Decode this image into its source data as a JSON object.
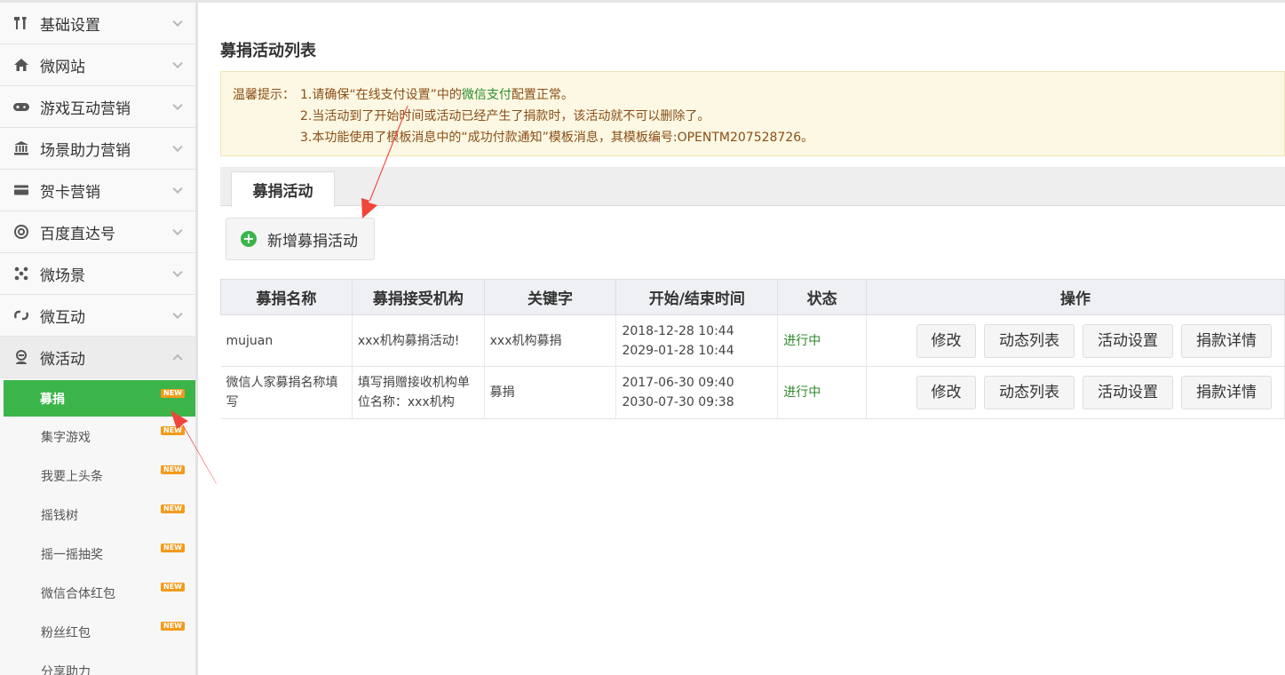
{
  "sidebar": {
    "menu": [
      {
        "label": "基础设置",
        "icon": "tools-icon"
      },
      {
        "label": "微网站",
        "icon": "home-icon"
      },
      {
        "label": "游戏互动营销",
        "icon": "gamepad-icon"
      },
      {
        "label": "场景助力营销",
        "icon": "bank-icon"
      },
      {
        "label": "贺卡营销",
        "icon": "card-icon"
      },
      {
        "label": "百度直达号",
        "icon": "at-icon"
      },
      {
        "label": "微场景",
        "icon": "molecule-icon"
      },
      {
        "label": "微互动",
        "icon": "link-icon"
      },
      {
        "label": "微活动",
        "icon": "user-icon"
      }
    ],
    "submenu": [
      {
        "label": "募捐",
        "badge": "NEW"
      },
      {
        "label": "集字游戏",
        "badge": "NEW"
      },
      {
        "label": "我要上头条",
        "badge": "NEW"
      },
      {
        "label": "摇钱树",
        "badge": "NEW"
      },
      {
        "label": "摇一摇抽奖",
        "badge": "NEW"
      },
      {
        "label": "微信合体红包",
        "badge": "NEW"
      },
      {
        "label": "粉丝红包",
        "badge": "NEW"
      },
      {
        "label": "分享助力",
        "badge": ""
      }
    ]
  },
  "page": {
    "title": "募捐活动列表"
  },
  "notice": {
    "lead": "温馨提示：",
    "line1_pre": "1.请确保“在线支付设置”中的",
    "line1_link": "微信支付",
    "line1_post": "配置正常。",
    "line2": "2.当活动到了开始时间或活动已经产生了捐款时，该活动就不可以删除了。",
    "line3": "3.本功能使用了模板消息中的“成功付款通知”模板消息，其模板编号:OPENTM207528726。"
  },
  "tabs": [
    {
      "label": "募捐活动"
    }
  ],
  "add_button": {
    "label": "新增募捐活动"
  },
  "table": {
    "headers": [
      "募捐名称",
      "募捐接受机构",
      "关键字",
      "开始/结束时间",
      "状态",
      "操作"
    ],
    "rows": [
      {
        "name": "mujuan",
        "org": "xxx机构募捐活动!",
        "keyword": "xxx机构募捐",
        "start": "2018-12-28 10:44",
        "end": "2029-01-28 10:44",
        "status": "进行中"
      },
      {
        "name": "微信人家募捐名称填写",
        "org": "填写捐赠接收机构单位名称：xxx机构",
        "keyword": "募捐",
        "start": "2017-06-30 09:40",
        "end": "2030-07-30 09:38",
        "status": "进行中"
      }
    ],
    "actions": [
      "修改",
      "动态列表",
      "活动设置",
      "捐款详情"
    ]
  },
  "colors": {
    "accent_green": "#3bb54a",
    "badge_orange": "#f29b1c",
    "annotation_red": "#f0453a"
  }
}
